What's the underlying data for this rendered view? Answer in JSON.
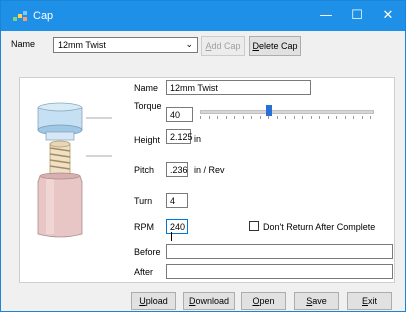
{
  "window": {
    "title": "Cap",
    "minimize_glyph": "—",
    "maximize_glyph": "☐",
    "close_glyph": "✕"
  },
  "toolbar": {
    "name_label": "Name",
    "selected_cap": "12mm Twist",
    "add_cap_prefix": "A",
    "add_cap_rest": "dd Cap",
    "delete_cap_prefix": "D",
    "delete_cap_rest": "elete Cap"
  },
  "form": {
    "name_label": "Name",
    "name_value": "12mm Twist",
    "torque_label": "Torque",
    "torque_value": "40",
    "torque_slider_fraction": 0.4,
    "height_label": "Height",
    "height_value": "2.125",
    "height_unit": "in",
    "pitch_label": "Pitch",
    "pitch_value": ".236",
    "pitch_unit": "in / Rev",
    "turn_label": "Turn",
    "turn_value": "4",
    "rpm_label": "RPM",
    "rpm_value": "240",
    "dont_return_label": "Don't Return After Complete",
    "dont_return_checked": false,
    "before_label": "Before",
    "before_value": "",
    "after_label": "After",
    "after_value": ""
  },
  "buttons": {
    "upload_prefix": "U",
    "upload_rest": "pload",
    "download_prefix": "D",
    "download_rest": "ownload",
    "open_prefix": "O",
    "open_rest": "pen",
    "save_prefix": "S",
    "save_rest": "ave",
    "exit_prefix": "E",
    "exit_rest": "xit"
  },
  "colors": {
    "titlebar": "#1e90e8",
    "accent": "#0078d7",
    "slider_thumb": "#2a6fd6"
  }
}
